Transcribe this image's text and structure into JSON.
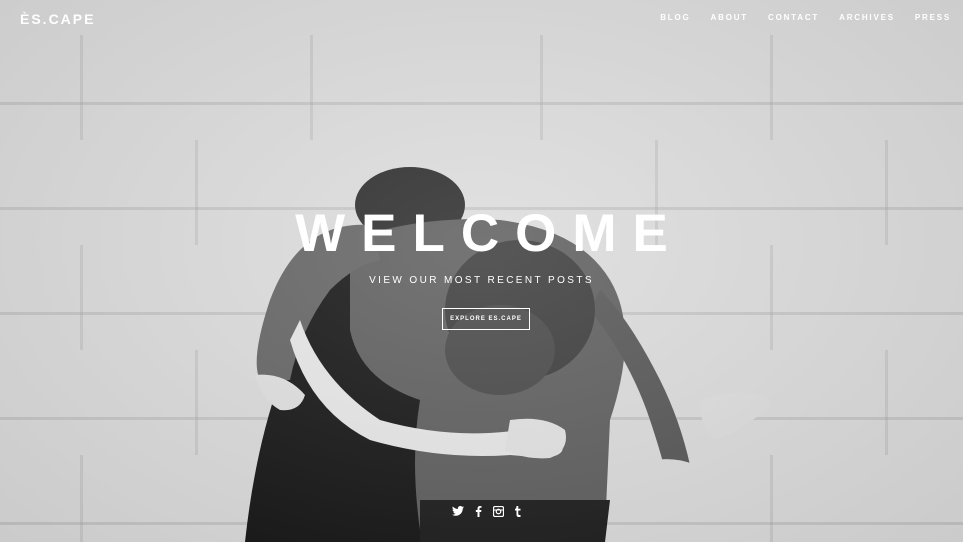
{
  "header": {
    "logo": "ÈS.CAPE",
    "nav": [
      {
        "label": "BLOG"
      },
      {
        "label": "ABOUT"
      },
      {
        "label": "CONTACT"
      },
      {
        "label": "ARCHIVES"
      },
      {
        "label": "PRESS"
      }
    ]
  },
  "hero": {
    "title": "WELCOME",
    "subtitle": "VIEW OUR MOST RECENT POSTS",
    "cta_label": "EXPLORE ES.CAPE"
  },
  "social": [
    {
      "icon": "twitter-icon"
    },
    {
      "icon": "facebook-icon"
    },
    {
      "icon": "instagram-icon"
    },
    {
      "icon": "tumblr-icon"
    }
  ],
  "colors": {
    "text": "#ffffff",
    "wall": "#dcdcdc"
  }
}
